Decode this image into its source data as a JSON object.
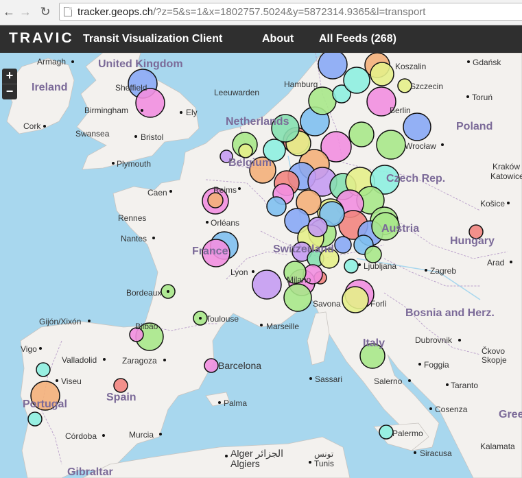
{
  "browser": {
    "url_host": "tracker.geops.ch",
    "url_rest": "/?z=5&s=1&x=1802757.5024&y=5872314.9365&l=transport"
  },
  "navbar": {
    "logo": "TRAVIC",
    "title": "Transit Visualization Client",
    "about": "About",
    "feeds": "All Feeds (268)"
  },
  "zoom": {
    "in": "+",
    "out": "−"
  },
  "countries": [
    {
      "id": "uk",
      "label": "United Kingdom"
    },
    {
      "id": "ireland",
      "label": "Ireland"
    },
    {
      "id": "netherlands",
      "label": "Netherlands"
    },
    {
      "id": "belgium",
      "label": "Belgium"
    },
    {
      "id": "poland",
      "label": "Poland"
    },
    {
      "id": "czech",
      "label": "Czech Rep."
    },
    {
      "id": "austria",
      "label": "Austria"
    },
    {
      "id": "hungary",
      "label": "Hungary"
    },
    {
      "id": "france",
      "label": "France"
    },
    {
      "id": "switzerland",
      "label": "Switzerland"
    },
    {
      "id": "bosnia",
      "label": "Bosnia and Herz."
    },
    {
      "id": "italy",
      "label": "Italy"
    },
    {
      "id": "spain",
      "label": "Spain"
    },
    {
      "id": "portugal",
      "label": "Portugal"
    },
    {
      "id": "gibraltar",
      "label": "Gibraltar"
    },
    {
      "id": "greece",
      "label": "Gree"
    }
  ],
  "cities": [
    {
      "id": "armagh",
      "label": "Armagh"
    },
    {
      "id": "sheffield",
      "label": "Sheffield"
    },
    {
      "id": "birmingham",
      "label": "Birmingham"
    },
    {
      "id": "ely",
      "label": "Ely"
    },
    {
      "id": "cork",
      "label": "Cork"
    },
    {
      "id": "swansea",
      "label": "Swansea"
    },
    {
      "id": "bristol",
      "label": "Bristol"
    },
    {
      "id": "plymouth",
      "label": "Plymouth"
    },
    {
      "id": "leeuwarden",
      "label": "Leeuwarden"
    },
    {
      "id": "hamburg",
      "label": "Hamburg"
    },
    {
      "id": "koszalin",
      "label": "Koszalin"
    },
    {
      "id": "gdansk",
      "label": "Gdańsk"
    },
    {
      "id": "szczecin",
      "label": "Szczecin"
    },
    {
      "id": "torun",
      "label": "Toruń"
    },
    {
      "id": "berlin",
      "label": "Berlin"
    },
    {
      "id": "wroclaw",
      "label": "Wrocław"
    },
    {
      "id": "krakow",
      "label": "Kraków"
    },
    {
      "id": "katowice",
      "label": "Katowice"
    },
    {
      "id": "kosice",
      "label": "Košice"
    },
    {
      "id": "caen",
      "label": "Caen"
    },
    {
      "id": "reims",
      "label": "Reims"
    },
    {
      "id": "rennes",
      "label": "Rennes"
    },
    {
      "id": "orleans",
      "label": "Orléans"
    },
    {
      "id": "nantes",
      "label": "Nantes"
    },
    {
      "id": "lyon",
      "label": "Lyon"
    },
    {
      "id": "milano",
      "label": "Milano"
    },
    {
      "id": "ljubljana",
      "label": "Ljubljana"
    },
    {
      "id": "zagreb",
      "label": "Zagreb"
    },
    {
      "id": "arad",
      "label": "Arad"
    },
    {
      "id": "bordeaux",
      "label": "Bordeaux"
    },
    {
      "id": "savona",
      "label": "Savona"
    },
    {
      "id": "forli",
      "label": "Forlì"
    },
    {
      "id": "gijon",
      "label": "Gijón/Xixón"
    },
    {
      "id": "toulouse",
      "label": "Toulouse"
    },
    {
      "id": "marseille",
      "label": "Marseille"
    },
    {
      "id": "bilbao",
      "label": "Bilbao"
    },
    {
      "id": "dubrovnik",
      "label": "Dubrovnik"
    },
    {
      "id": "vigo",
      "label": "Vigo"
    },
    {
      "id": "valladolid",
      "label": "Valladolid"
    },
    {
      "id": "zaragoza",
      "label": "Zaragoza"
    },
    {
      "id": "skopje",
      "label": "Čkovo\nSkopje"
    },
    {
      "id": "viseu",
      "label": "Viseu"
    },
    {
      "id": "barcelona",
      "label": "Barcelona"
    },
    {
      "id": "sassari",
      "label": "Sassari"
    },
    {
      "id": "foggia",
      "label": "Foggia"
    },
    {
      "id": "salerno",
      "label": "Salerno"
    },
    {
      "id": "taranto",
      "label": "Taranto"
    },
    {
      "id": "palma",
      "label": "Palma"
    },
    {
      "id": "cosenza",
      "label": "Cosenza"
    },
    {
      "id": "cordoba",
      "label": "Córdoba"
    },
    {
      "id": "murcia",
      "label": "Murcia"
    },
    {
      "id": "palermo",
      "label": "Palermo"
    },
    {
      "id": "algiers",
      "label": "Alger الجزائر\nAlgiers"
    },
    {
      "id": "tunis",
      "label": "تونس\nTunis"
    },
    {
      "id": "siracusa",
      "label": "Siracusa"
    },
    {
      "id": "kalamata",
      "label": "Kalamata"
    }
  ]
}
